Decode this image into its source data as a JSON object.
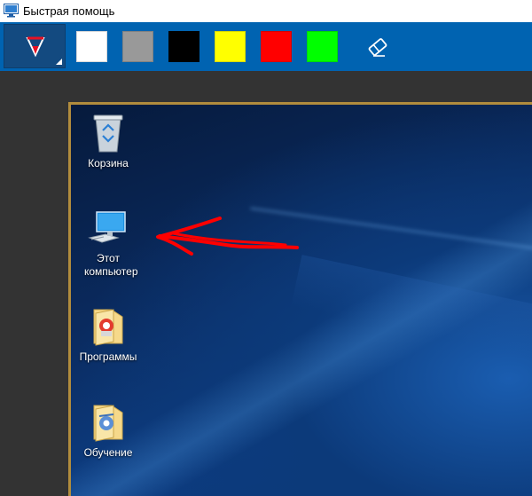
{
  "window": {
    "title": "Быстрая помощь"
  },
  "toolbar": {
    "pen_tool": "pen-icon",
    "colors": [
      "#ffffff",
      "#999999",
      "#000000",
      "#ffff00",
      "#ff0000",
      "#00ff00"
    ],
    "eraser_tool": "eraser-icon",
    "accent": "#0063b1"
  },
  "desktop": {
    "icons": [
      {
        "label": "Корзина",
        "icon": "recycle-bin-icon"
      },
      {
        "label": "Этот компьютер",
        "icon": "computer-icon"
      },
      {
        "label": "Программы",
        "icon": "folder-icon"
      },
      {
        "label": "Обучение",
        "icon": "folder-icon"
      }
    ],
    "annotation_color": "#ff0000"
  }
}
